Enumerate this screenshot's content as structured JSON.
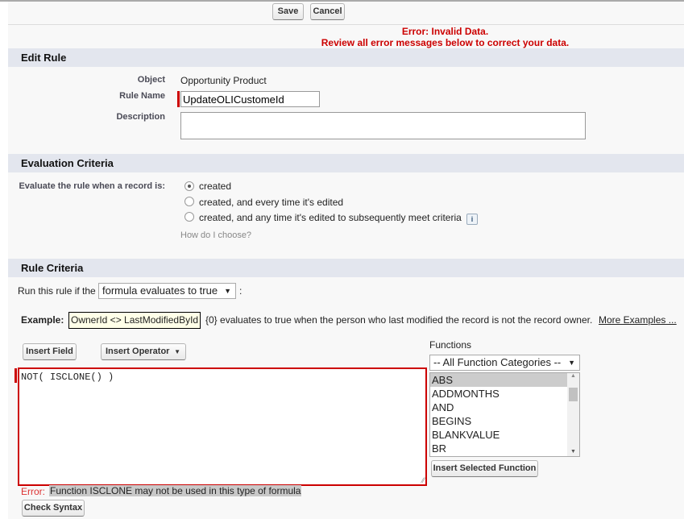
{
  "toolbar": {
    "save_label": "Save",
    "cancel_label": "Cancel"
  },
  "error_banner": {
    "line1": "Error: Invalid Data.",
    "line2": "Review all error messages below to correct your data."
  },
  "edit_rule": {
    "title": "Edit Rule",
    "object_label": "Object",
    "object_value": "Opportunity Product",
    "rule_name_label": "Rule Name",
    "rule_name_value": "UpdateOLICustomeId",
    "description_label": "Description",
    "description_value": ""
  },
  "evaluation": {
    "title": "Evaluation Criteria",
    "label": "Evaluate the rule when a record is:",
    "options": [
      "created",
      "created, and every time it's edited",
      "created, and any time it's edited to subsequently meet criteria"
    ],
    "selected": "created",
    "info_icon": "i",
    "help_link": "How do I choose?"
  },
  "rule_criteria": {
    "title": "Rule Criteria",
    "run_prefix": "Run this rule if the",
    "run_select": "formula evaluates to true",
    "run_suffix": ":",
    "example_label": "Example:",
    "example_formula": "OwnerId <> LastModifiedById",
    "example_text": "{0} evaluates to true when the person who last modified the record is not the record owner.",
    "more_examples": "More Examples ...",
    "insert_field": "Insert Field",
    "insert_operator": "Insert Operator",
    "formula": "NOT( ISCLONE() )",
    "functions_label": "Functions",
    "function_category": "-- All Function Categories --",
    "functions": [
      "ABS",
      "ADDMONTHS",
      "AND",
      "BEGINS",
      "BLANKVALUE",
      "BR"
    ],
    "selected_function": "ABS",
    "insert_selected_function": "Insert Selected Function",
    "error_label": "Error:",
    "error_message": "Function ISCLONE may not be used in this type of formula",
    "check_syntax": "Check Syntax"
  }
}
